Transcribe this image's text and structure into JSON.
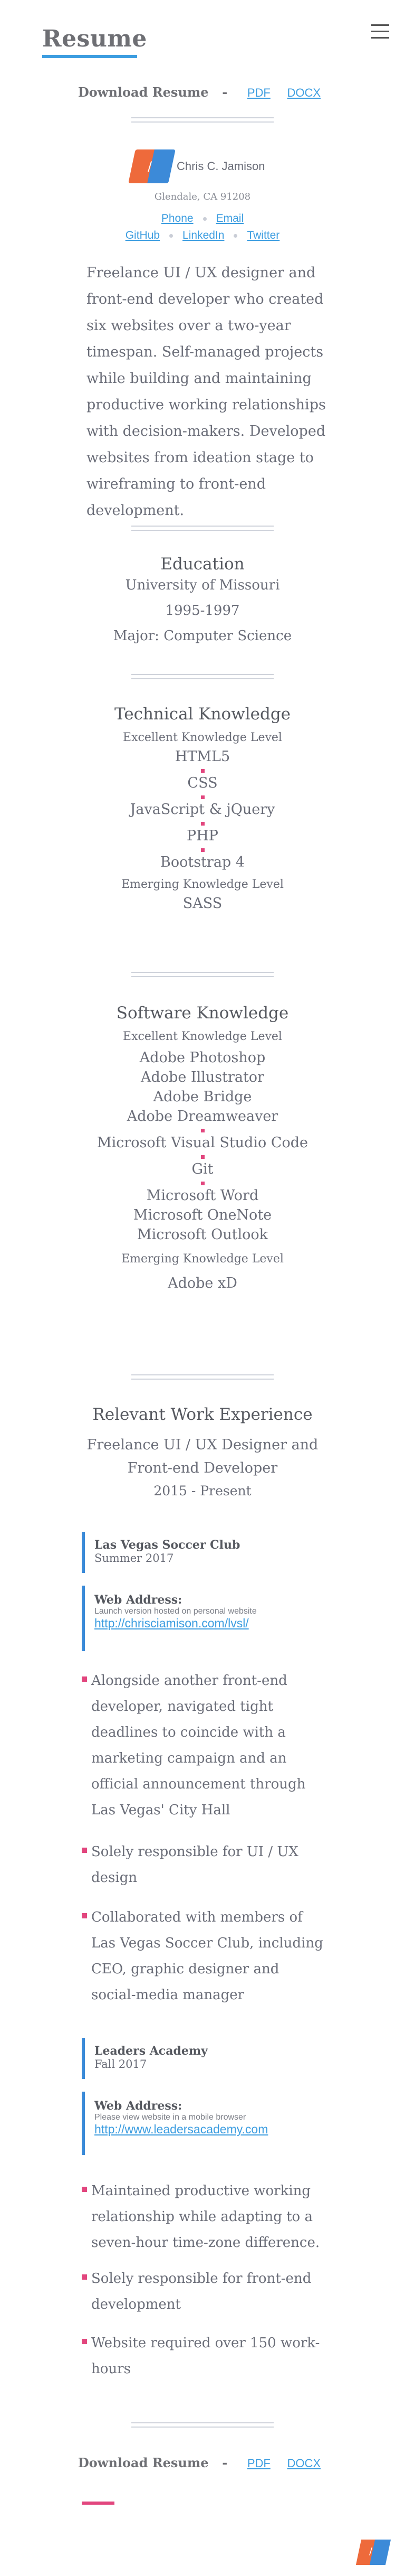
{
  "header": {
    "title": "Resume",
    "menu_icon": "hamburger-menu-icon"
  },
  "download": {
    "label": "Download Resume",
    "dash": "-",
    "pdf": "PDF",
    "docx": "DOCX"
  },
  "profile": {
    "logo_mark": "/",
    "name": "Chris C. Jamison",
    "location": "Glendale, CA 91208",
    "phone": "Phone",
    "email": "Email",
    "github": "GitHub",
    "linkedin": "LinkedIn",
    "twitter": "Twitter"
  },
  "summary": "Freelance UI / UX designer and front-end developer who created six websites over a two-year timespan. Self-managed projects while building and maintaining productive working relationships with decision-makers. Developed websites from ideation stage to wireframing to front-end development.",
  "education": {
    "title": "Education",
    "school": "University of Missouri",
    "years": "1995-1997",
    "major": "Major: Computer Science"
  },
  "technical": {
    "title": "Technical Knowledge",
    "excellent_label": "Excellent Knowledge Level",
    "excellent": [
      "HTML5",
      "CSS",
      "JavaScript & jQuery",
      "PHP",
      "Bootstrap 4"
    ],
    "emerging_label": "Emerging Knowledge Level",
    "emerging": [
      "SASS"
    ]
  },
  "software": {
    "title": "Software Knowledge",
    "excellent_label": "Excellent Knowledge Level",
    "adobe": [
      "Adobe Photoshop",
      "Adobe Illustrator",
      "Adobe Bridge",
      "Adobe Dreamweaver"
    ],
    "vs": "Microsoft Visual Studio Code",
    "git": "Git",
    "office": [
      "Microsoft Word",
      "Microsoft OneNote",
      "Microsoft Outlook"
    ],
    "emerging_label": "Emerging Knowledge Level",
    "emerging": [
      "Adobe xD"
    ]
  },
  "experience": {
    "title": "Relevant Work Experience",
    "role_line1": "Freelance UI / UX Designer and",
    "role_line2": "Front-end Developer",
    "dates": "2015 - Present",
    "jobs": [
      {
        "client": "Las Vegas Soccer Club",
        "term": "Summer 2017",
        "web_label": "Web Address:",
        "note": "Launch version hosted on personal website",
        "url": "http://chrisciamison.com/lvsl/",
        "bullets": [
          "Alongside another front-end developer, navigated tight deadlines to coincide with a marketing campaign and an official announcement through Las Vegas' City Hall",
          "Solely responsible for UI / UX design",
          "Collaborated with members of Las Vegas Soccer Club, including CEO, graphic designer and social-media manager"
        ]
      },
      {
        "client": "Leaders Academy",
        "term": "Fall 2017",
        "web_label": "Web Address:",
        "note": "Please view website in a mobile browser",
        "url": "http://www.leadersacademy.com",
        "bullets": [
          "Maintained productive working relationship while adapting to a seven-hour time-zone difference.",
          "Solely responsible for front-end development",
          "Website required over 150 work-hours"
        ]
      }
    ]
  },
  "colors": {
    "accent_blue": "#3c9de0",
    "accent_pink": "#e2467e",
    "logo_orange": "#ee6a3b",
    "logo_blue": "#3c8ad8"
  }
}
